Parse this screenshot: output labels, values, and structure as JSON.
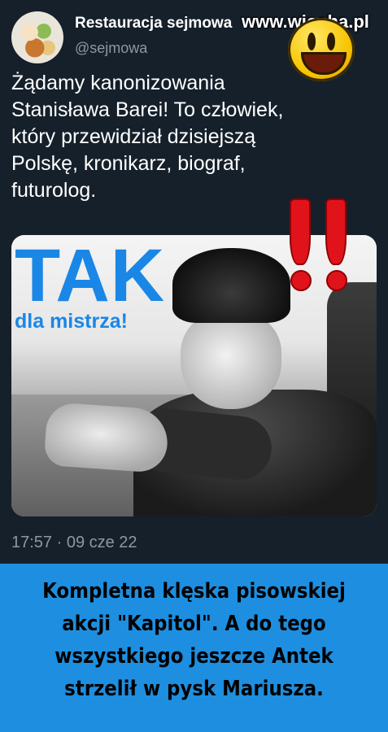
{
  "tweet": {
    "account_name": "Restauracja sejmowa",
    "handle": "@sejmowa",
    "text_lines": [
      "Żądamy kanonizowania",
      "Stanisława Barei! To człowiek,",
      "który przewidział dzisiejszą",
      "Polskę, kronikarz, biograf,",
      "futurolog."
    ],
    "media": {
      "headline": "TAK",
      "subline": "dla mistrza!"
    },
    "timestamp": "17:57 · 09 cze 22"
  },
  "watermark": "www.wiocha.pl",
  "emoji": "smiley-face-icon",
  "exclamation_marks": "!!",
  "caption": {
    "lines": [
      "Kompletna klęska pisowskiej",
      "akcji \"Kapitol\".  A do tego",
      "wszystkiego jeszcze Antek",
      "strzelił w pysk Mariusza."
    ]
  },
  "colors": {
    "background": "#15202b",
    "accent_blue": "#1a87e6",
    "banner_blue": "#1e8fe0",
    "exclamation_red": "#e0131b"
  }
}
